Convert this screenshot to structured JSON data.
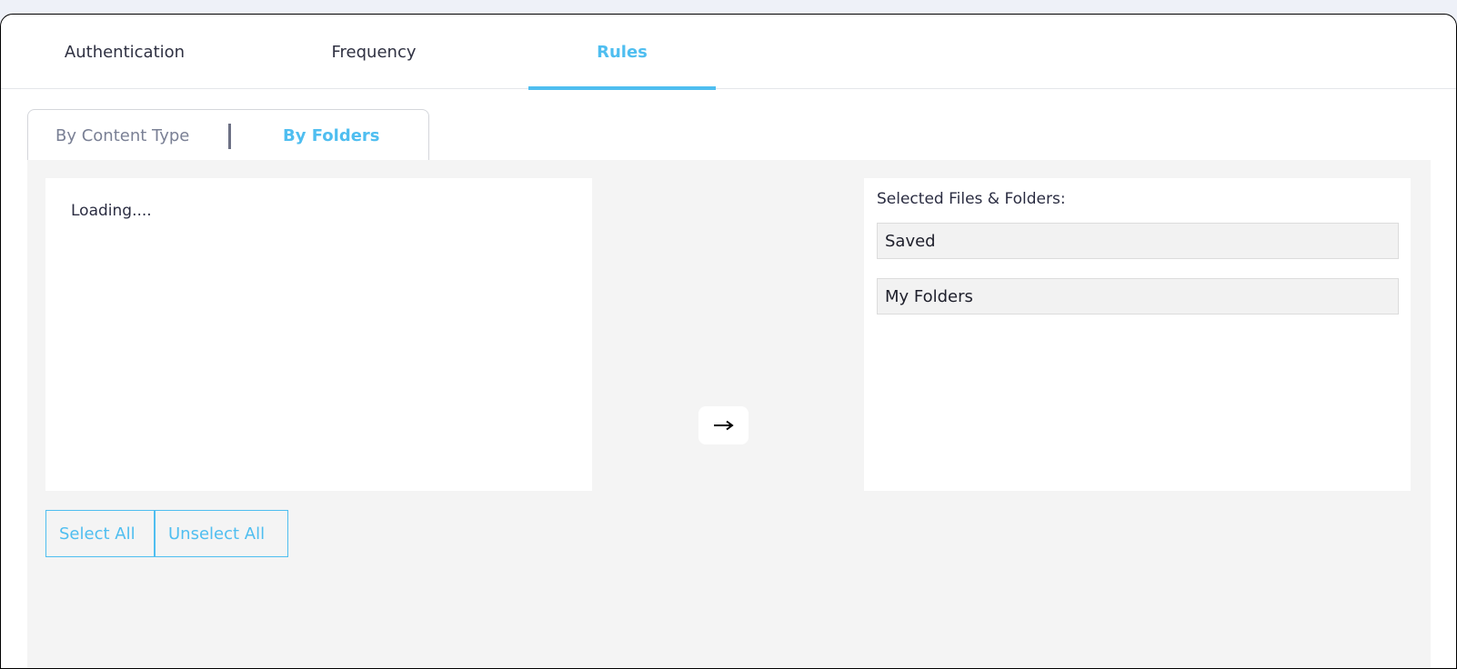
{
  "tabs": [
    {
      "label": "Authentication",
      "active": false
    },
    {
      "label": "Frequency",
      "active": false
    },
    {
      "label": "Rules",
      "active": true
    }
  ],
  "segmented": {
    "by_content_type": "By Content Type",
    "by_folders": "By Folders",
    "active": "by_folders"
  },
  "left_panel": {
    "status": "Loading...."
  },
  "right_panel": {
    "title": "Selected Files & Folders:",
    "items": [
      "Saved",
      "My Folders"
    ]
  },
  "actions": {
    "select_all": "Select All",
    "unselect_all": "Unselect All"
  },
  "icons": {
    "transfer": "arrow-right-icon"
  },
  "colors": {
    "accent": "#4fbef0",
    "panel_bg": "#f4f4f4"
  }
}
